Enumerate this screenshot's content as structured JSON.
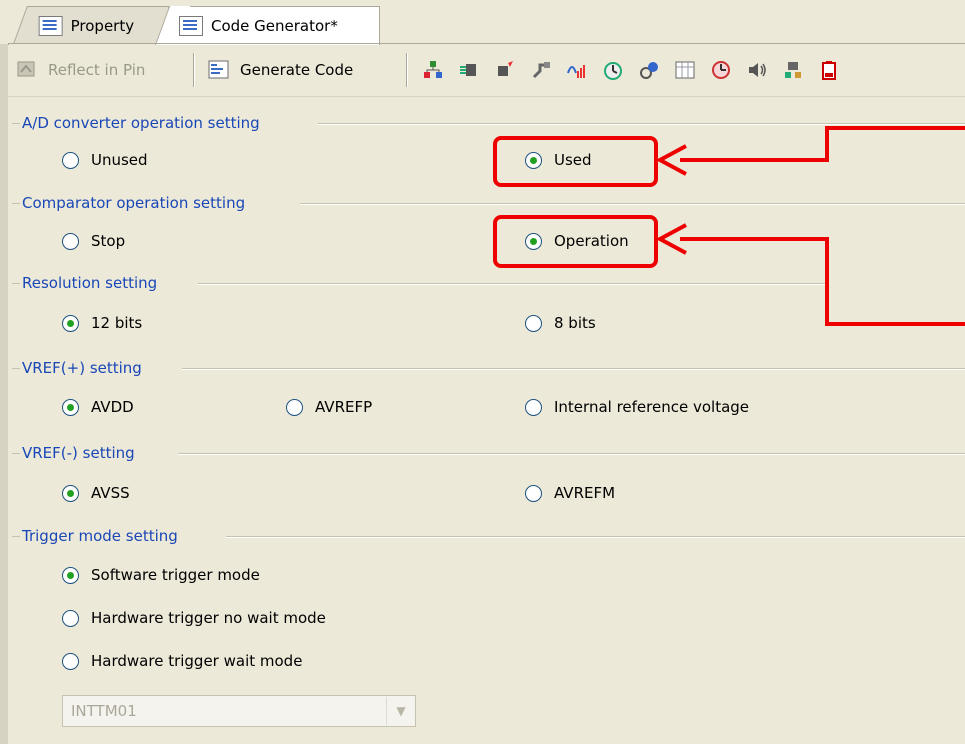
{
  "tabs": [
    {
      "label": "Property",
      "icon": "property-icon",
      "active": false
    },
    {
      "label": "Code Generator*",
      "icon": "code-generator-icon",
      "active": true
    }
  ],
  "toolbar": {
    "reflect_label": "Reflect in Pin",
    "generate_label": "Generate Code",
    "icons": [
      "clock-generator-icon",
      "port-icon",
      "interrupt-icon",
      "serial-icon",
      "adc-icon",
      "timer-icon",
      "watchdog-icon",
      "rtc-icon",
      "interval-timer-icon",
      "buzzer-icon",
      "data-transfer-icon",
      "battery-icon"
    ]
  },
  "sections": {
    "adc": {
      "title": "A/D converter operation setting",
      "opt1": "Unused",
      "opt2": "Used"
    },
    "comparator": {
      "title": "Comparator operation setting",
      "opt1": "Stop",
      "opt2": "Operation"
    },
    "resolution": {
      "title": "Resolution setting",
      "opt1": "12 bits",
      "opt2": "8 bits"
    },
    "vrefp": {
      "title": "VREF(+) setting",
      "opt1": "AVDD",
      "opt2": "AVREFP",
      "opt3": "Internal reference voltage"
    },
    "vrefm": {
      "title": "VREF(-) setting",
      "opt1": "AVSS",
      "opt2": "AVREFM"
    },
    "trigger": {
      "title": "Trigger mode setting",
      "opt1": "Software trigger mode",
      "opt2": "Hardware trigger no wait mode",
      "opt3": "Hardware trigger wait mode",
      "select_value": "INTTM01"
    }
  },
  "colors": {
    "highlight": "#ee0000",
    "section_title": "#1a47b7",
    "radio_dot": "#21a121"
  }
}
